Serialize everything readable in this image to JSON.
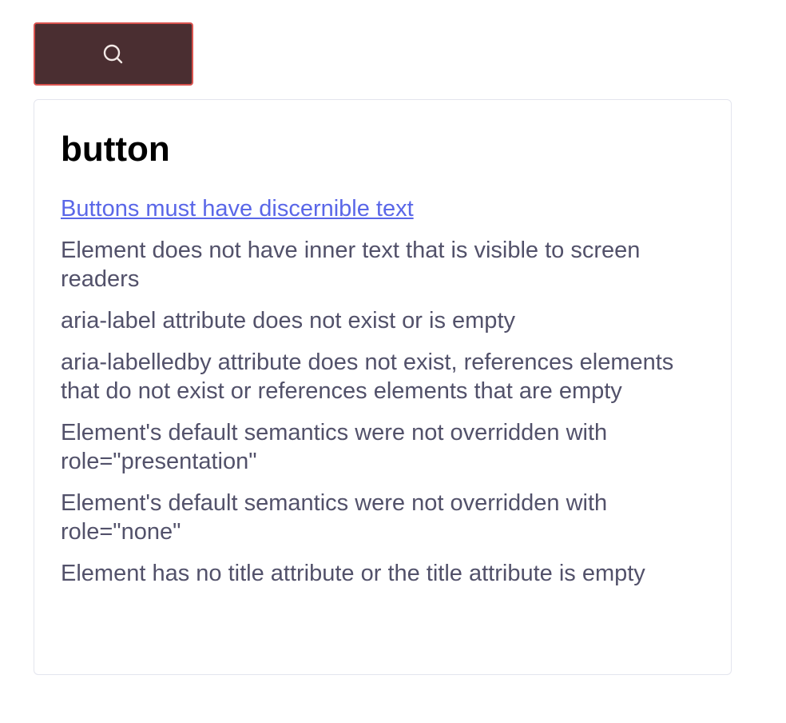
{
  "toolbar": {
    "search_button_icon": "search-icon",
    "search_button_bg": "#4a2e31",
    "search_button_border": "#d9534f"
  },
  "result": {
    "title": "button",
    "rule_link": "Buttons must have discernible text",
    "checks": [
      "Element does not have inner text that is visible to screen readers",
      "aria-label attribute does not exist or is empty",
      "aria-labelledby attribute does not exist, references elements that do not exist or references elements that are empty",
      "Element's default semantics were not overridden with role=\"presentation\"",
      "Element's default semantics were not overridden with role=\"none\"",
      "Element has no title attribute or the title attribute is empty"
    ],
    "link_color": "#5a67e8",
    "text_color": "#52516a"
  }
}
